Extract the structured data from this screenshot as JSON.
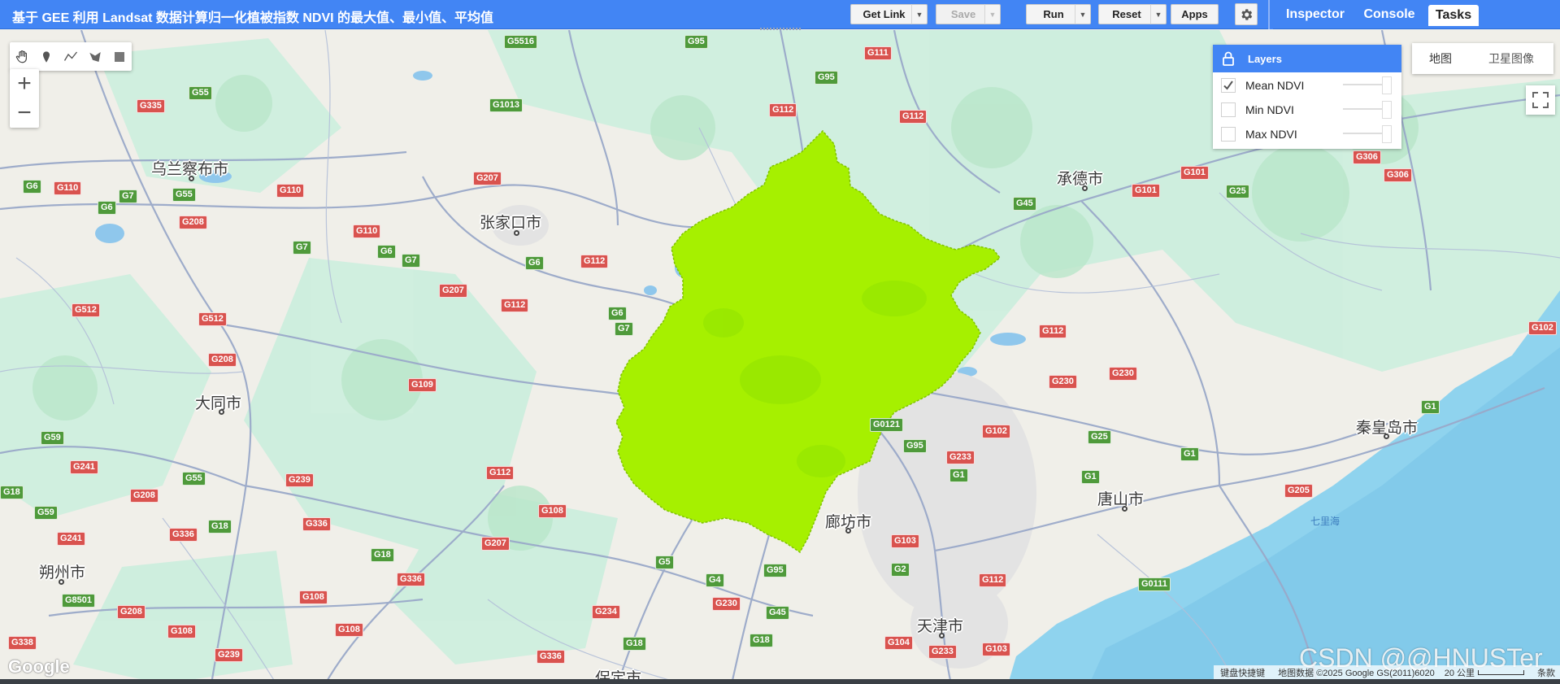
{
  "toolbar": {
    "title": "基于 GEE 利用 Landsat 数据计算归一化植被指数 NDVI 的最大值、最小值、平均值",
    "get_link": "Get Link",
    "save": "Save",
    "run": "Run",
    "reset": "Reset",
    "apps": "Apps"
  },
  "right_tabs": {
    "inspector": "Inspector",
    "console": "Console",
    "tasks": "Tasks",
    "active": "Tasks"
  },
  "layers": {
    "title": "Layers",
    "items": [
      {
        "name": "Mean NDVI",
        "checked": true
      },
      {
        "name": "Min NDVI",
        "checked": false
      },
      {
        "name": "Max NDVI",
        "checked": false
      }
    ]
  },
  "map_type": {
    "map": "地图",
    "satellite": "卫星图像"
  },
  "cities": {
    "wulanchabu": "乌兰察布市",
    "zhangjiakou": "张家口市",
    "chengde": "承德市",
    "datong": "大同市",
    "qinhuangdao": "秦皇岛市",
    "tangshan": "唐山市",
    "langfang": "廊坊市",
    "shuozhou": "朔州市",
    "tianjin": "天津市",
    "baoding": "保定市"
  },
  "sea_label": "七里海",
  "roads": {
    "r1": "G5516",
    "r2": "G95",
    "r3": "G111",
    "r4": "G55",
    "r5": "G335",
    "r6": "G1013",
    "r7": "G95",
    "r8": "G112",
    "r9": "G112",
    "r10": "G6",
    "r11": "G110",
    "r12": "G7",
    "r13": "G55",
    "r14": "G6",
    "r15": "G110",
    "r16": "G207",
    "r17": "G208",
    "r18": "G110",
    "r19": "G6",
    "r20": "G7",
    "r21": "G7",
    "r22": "G6",
    "r23": "G112",
    "r24": "G207",
    "r25": "G112",
    "r26": "G6",
    "r27": "G7",
    "r28": "G512",
    "r29": "G512",
    "r30": "G208",
    "r31": "G109",
    "r32": "G112",
    "r33": "G230",
    "r34": "G230",
    "r35": "G0121",
    "r36": "G102",
    "r37": "G95",
    "r38": "G233",
    "r39": "G25",
    "r40": "G1",
    "r41": "G59",
    "r42": "G241",
    "r43": "G18",
    "r44": "G208",
    "r45": "G55",
    "r46": "G239",
    "r47": "G112",
    "r48": "G336",
    "r49": "G59",
    "r50": "G241",
    "r51": "G336",
    "r52": "G18",
    "r53": "G108",
    "r54": "G1",
    "r55": "G1",
    "r56": "G205",
    "r57": "G1",
    "r58": "G207",
    "r59": "G103",
    "r60": "G5",
    "r61": "G95",
    "r62": "G2",
    "r63": "G18",
    "r64": "G336",
    "r65": "G4",
    "r66": "G112",
    "r67": "G0111",
    "r68": "G8501",
    "r69": "G108",
    "r70": "G230",
    "r71": "G234",
    "r72": "G45",
    "r73": "G208",
    "r74": "G108",
    "r75": "G108",
    "r76": "G18",
    "r77": "G18",
    "r78": "G104",
    "r79": "G233",
    "r80": "G103",
    "r81": "G338",
    "r82": "G239",
    "r83": "G336",
    "r84": "G306",
    "r85": "G306",
    "r86": "G101",
    "r87": "G101",
    "r88": "G25",
    "r89": "G45",
    "r90": "G102",
    "r91": "G1"
  },
  "footer": {
    "shortcuts": "键盘快捷键",
    "map_data": "地图数据 ©2025 Google GS(2011)6020",
    "scale": "20 公里",
    "terms": "条款"
  },
  "google_logo": "Google",
  "watermark": "CSDN @@HNUSTer",
  "colors": {
    "accent": "#4285f4",
    "ndvi_fill": "#a6f000",
    "road_red": "#d9534f",
    "road_green": "#4f9a3b"
  }
}
